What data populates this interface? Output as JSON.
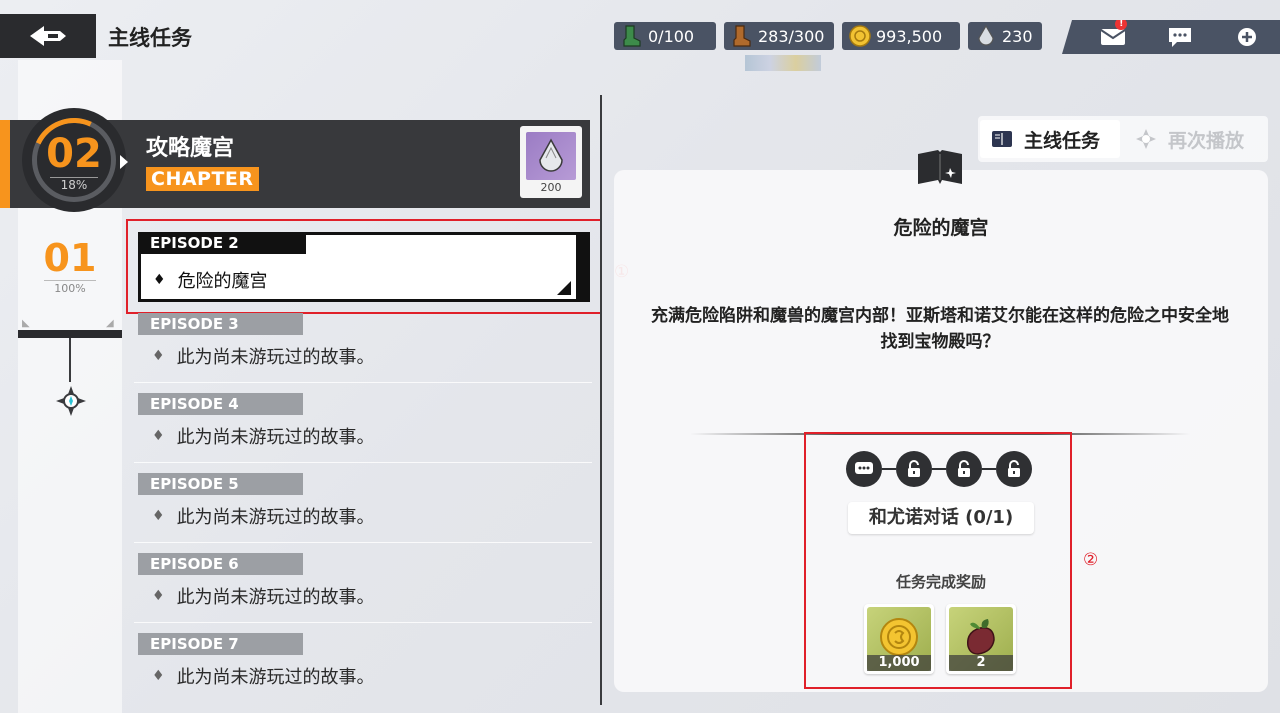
{
  "header": {
    "title": "主线任务"
  },
  "resources": [
    {
      "icon": "green-boot-icon",
      "value": "0/100"
    },
    {
      "icon": "brown-boot-icon",
      "value": "283/300"
    },
    {
      "icon": "gold-coin-icon",
      "value": "993,500"
    },
    {
      "icon": "crystal-drop-icon",
      "value": "230"
    }
  ],
  "top_buttons": {
    "mail_badge": "!"
  },
  "chapter": {
    "number": "02",
    "progress": "18%",
    "title": "攻略魔宫",
    "tag": "CHAPTER",
    "reward_count": "200"
  },
  "chapter_prev": {
    "number": "01",
    "progress": "100%"
  },
  "episodes": [
    {
      "label": "EPISODE 2",
      "title": "危险的魔宫"
    },
    {
      "label": "EPISODE 3",
      "title": "此为尚未游玩过的故事。"
    },
    {
      "label": "EPISODE 4",
      "title": "此为尚未游玩过的故事。"
    },
    {
      "label": "EPISODE 5",
      "title": "此为尚未游玩过的故事。"
    },
    {
      "label": "EPISODE 6",
      "title": "此为尚未游玩过的故事。"
    },
    {
      "label": "EPISODE 7",
      "title": "此为尚未游玩过的故事。"
    }
  ],
  "tabs": {
    "main": "主线任务",
    "replay": "再次播放"
  },
  "detail": {
    "title": "危险的魔宫",
    "description": "充满危险陷阱和魔兽的魔宫内部！亚斯塔和诺艾尔能在这样的危险之中安全地找到宝物殿吗？",
    "objective": "和尤诺对话 (0/1)",
    "reward_label": "任务完成奖励",
    "rewards": [
      {
        "icon": "gold-coin-icon",
        "count": "1,000"
      },
      {
        "icon": "sweet-potato-icon",
        "count": "2"
      }
    ]
  },
  "annotations": {
    "mark1": "①",
    "mark2": "②"
  },
  "colors": {
    "accent": "#f7941d",
    "highlight_box": "#e0202a",
    "dark": "#2a2b2e"
  }
}
